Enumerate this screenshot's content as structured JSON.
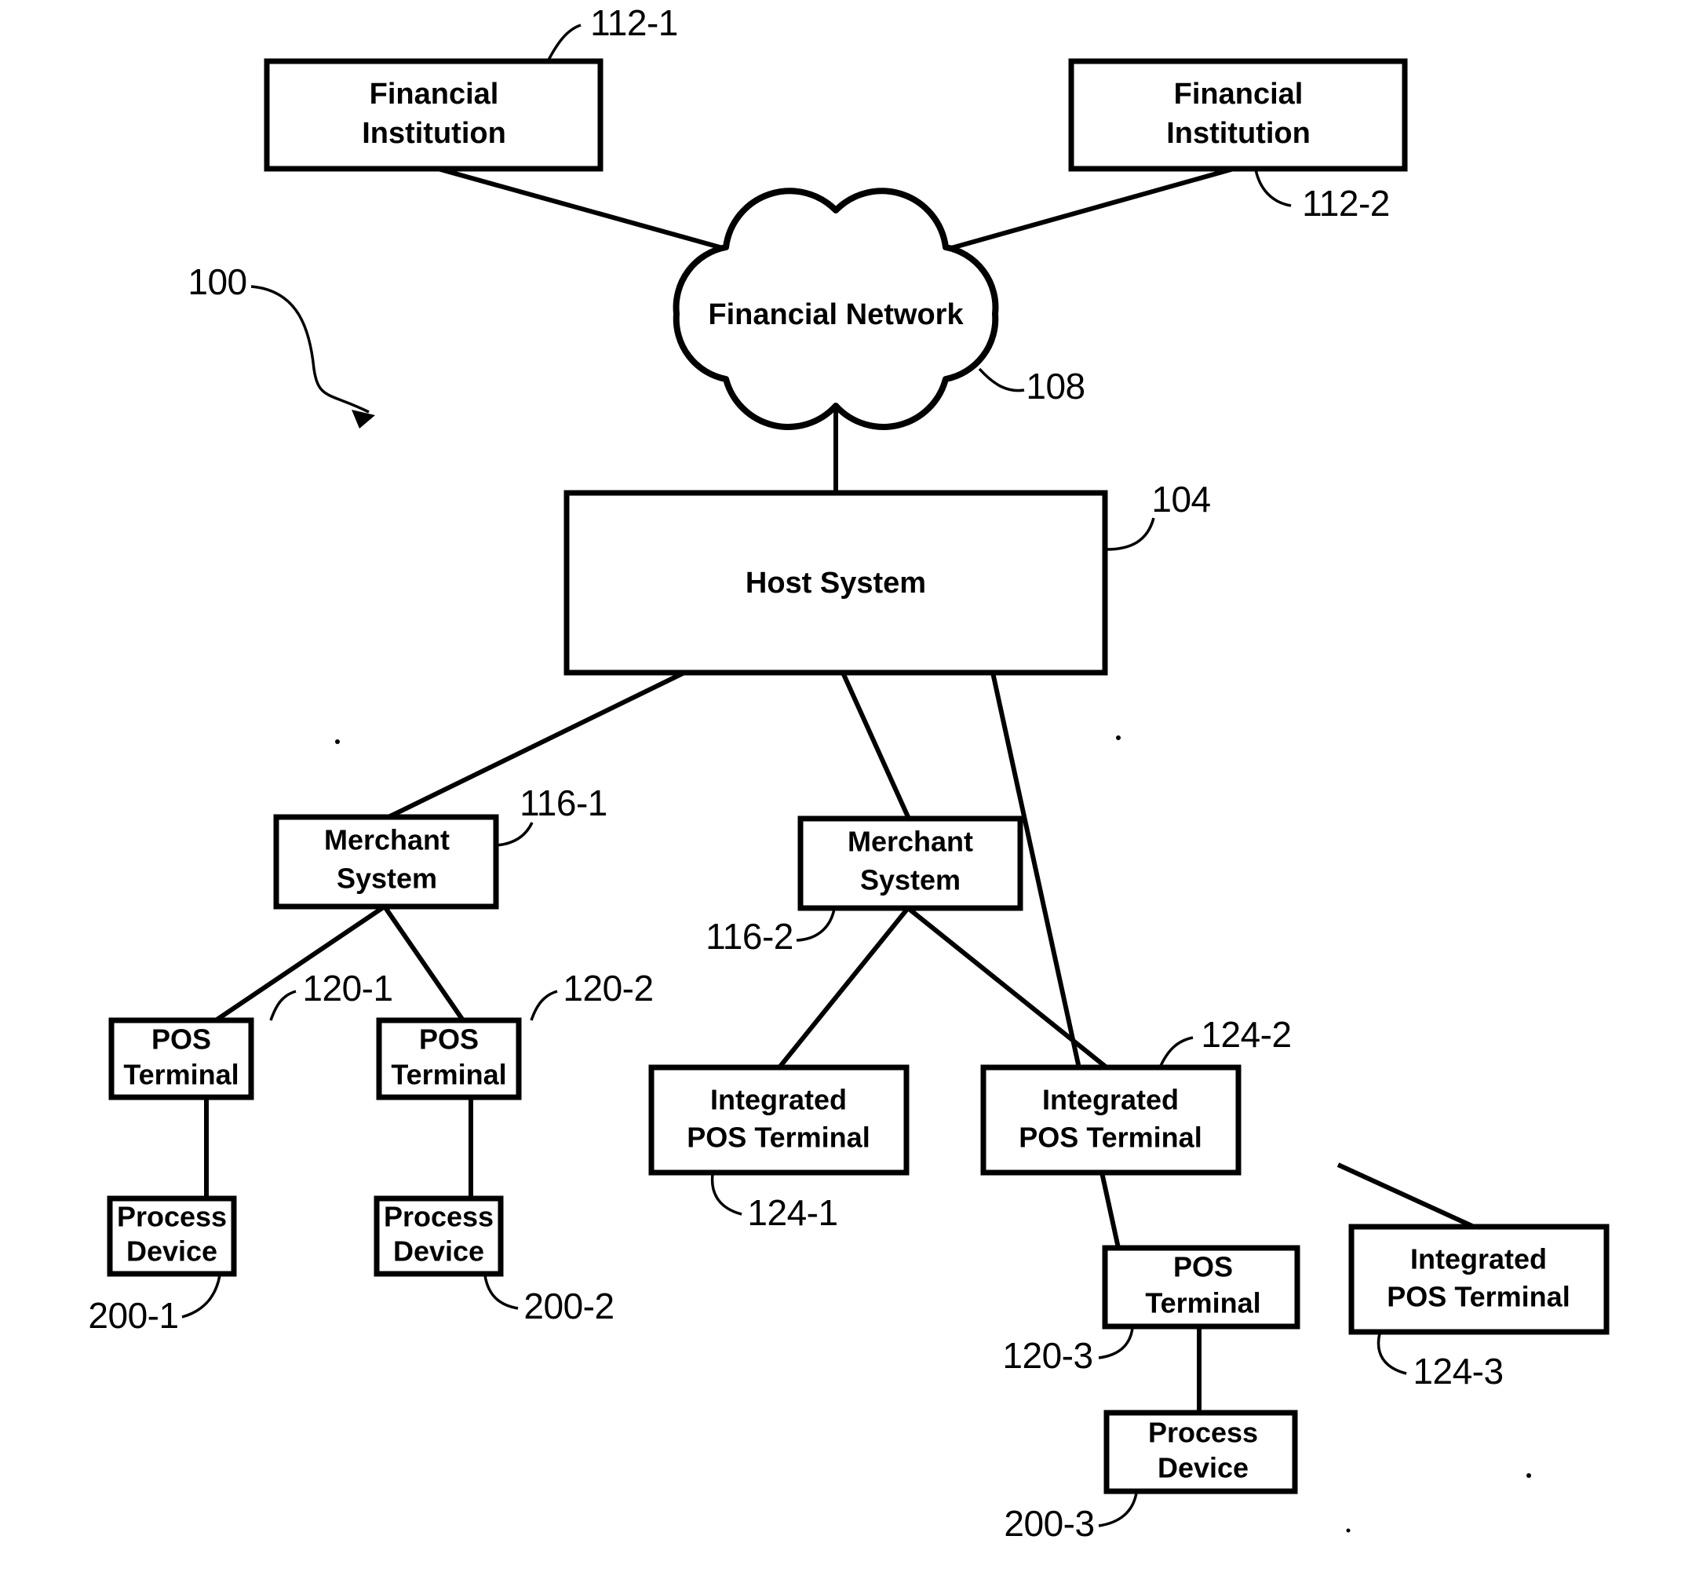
{
  "figure": {
    "type": "patent-system-block-diagram",
    "overall_ref": "100",
    "background_color": "#ffffff",
    "line_color": "#000000"
  },
  "nodes": {
    "financial_institution_1": {
      "line1": "Financial",
      "line2": "Institution",
      "ref": "112-1"
    },
    "financial_institution_2": {
      "line1": "Financial",
      "line2": "Institution",
      "ref": "112-2"
    },
    "financial_network": {
      "label": "Financial Network",
      "ref": "108"
    },
    "host_system": {
      "label": "Host System",
      "ref": "104"
    },
    "merchant_system_1": {
      "line1": "Merchant",
      "line2": "System",
      "ref": "116-1"
    },
    "merchant_system_2": {
      "line1": "Merchant",
      "line2": "System",
      "ref": "116-2"
    },
    "pos_terminal_1": {
      "line1": "POS",
      "line2": "Terminal",
      "ref": "120-1"
    },
    "pos_terminal_2": {
      "line1": "POS",
      "line2": "Terminal",
      "ref": "120-2"
    },
    "pos_terminal_3": {
      "line1": "POS",
      "line2": "Terminal",
      "ref": "120-3"
    },
    "process_device_1": {
      "line1": "Process",
      "line2": "Device",
      "ref": "200-1"
    },
    "process_device_2": {
      "line1": "Process",
      "line2": "Device",
      "ref": "200-2"
    },
    "process_device_3": {
      "line1": "Process",
      "line2": "Device",
      "ref": "200-3"
    },
    "integrated_pos_terminal_1": {
      "line1": "Integrated",
      "line2": "POS Terminal",
      "ref": "124-1"
    },
    "integrated_pos_terminal_2": {
      "line1": "Integrated",
      "line2": "POS Terminal",
      "ref": "124-2"
    },
    "integrated_pos_terminal_3": {
      "line1": "Integrated",
      "line2": "POS Terminal",
      "ref": "124-3"
    }
  }
}
